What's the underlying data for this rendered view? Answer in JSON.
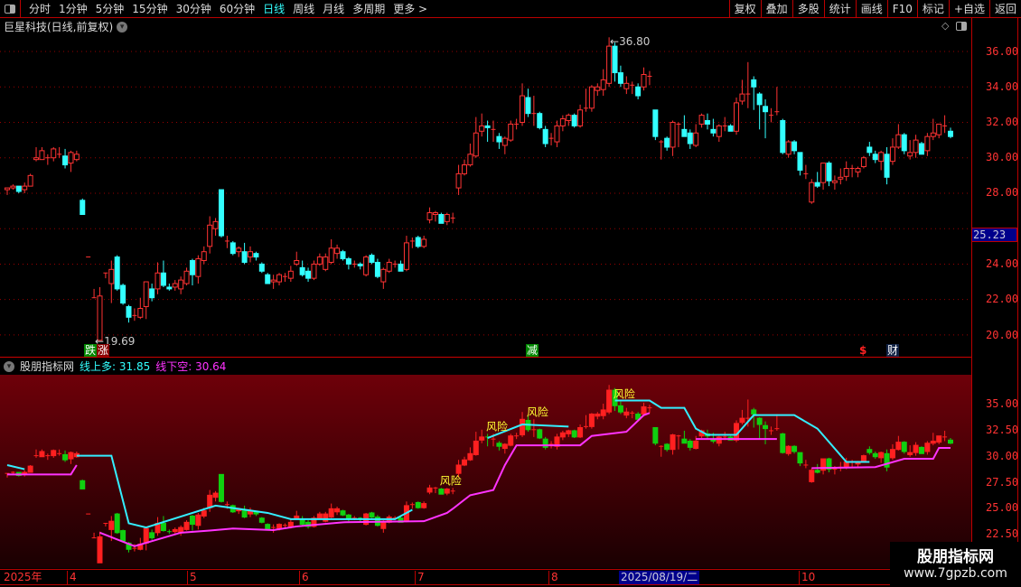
{
  "toolbar": {
    "periods": [
      "分时",
      "1分钟",
      "5分钟",
      "15分钟",
      "30分钟",
      "60分钟",
      "日线",
      "周线",
      "月线",
      "多周期",
      "更多 >"
    ],
    "active": "日线",
    "buttons": [
      "复权",
      "叠加",
      "多股",
      "统计",
      "画线",
      "F10",
      "标记",
      "+自选",
      "返回"
    ]
  },
  "header": {
    "title": "巨星科技(日线,前复权)"
  },
  "main_axis": {
    "labels": [
      "36.00",
      "34.00",
      "32.00",
      "30.00",
      "28.00",
      "24.00",
      "22.00",
      "20.00"
    ],
    "current_price": "25.23"
  },
  "annotations": {
    "high": "36.80",
    "low": "19.69",
    "die": "跌",
    "zhang": "涨",
    "jian": "减",
    "dollar": "$",
    "cai": "财",
    "risk": "风险"
  },
  "indicator": {
    "name": "股朋指标网",
    "upper_label": "线上多: 31.85",
    "lower_label": "线下空: 30.64",
    "axis": [
      "35.00",
      "32.50",
      "30.00",
      "27.50",
      "25.00",
      "22.50"
    ]
  },
  "time_axis": {
    "labels": [
      "2025年",
      "4",
      "5",
      "6",
      "7",
      "8",
      "10"
    ],
    "cursor_date": "2025/08/19/二"
  },
  "watermark": {
    "name": "股朋指标网",
    "url": "www.7gpzb.com"
  },
  "colors": {
    "up": "#ff3333",
    "down": "#33ffff",
    "upper_line": "#33eeff",
    "lower_line": "#ff33ff",
    "ind_up": "#ff2020",
    "ind_down": "#10d010",
    "risk": "#ffff33"
  },
  "chart_data": {
    "type": "candlestick",
    "ohlc": [
      [
        28.2,
        28.3,
        27.9,
        28.3
      ],
      [
        28.3,
        28.5,
        28.2,
        28.4
      ],
      [
        28.4,
        28.4,
        28.0,
        28.1
      ],
      [
        28.2,
        28.6,
        28.0,
        28.4
      ],
      [
        28.4,
        29.1,
        28.4,
        29.0
      ],
      [
        29.9,
        30.6,
        29.8,
        30.0
      ],
      [
        29.9,
        30.6,
        29.9,
        30.4
      ],
      [
        30.0,
        30.2,
        29.6,
        30.0
      ],
      [
        30.0,
        30.6,
        29.8,
        30.5
      ],
      [
        30.2,
        30.6,
        30.0,
        30.2
      ],
      [
        30.1,
        30.5,
        29.4,
        29.6
      ],
      [
        29.7,
        30.4,
        29.2,
        30.3
      ],
      [
        29.9,
        30.4,
        29.8,
        30.2
      ],
      [
        27.6,
        27.7,
        26.8,
        26.8
      ],
      [
        24.4,
        24.4,
        24.4,
        24.4
      ],
      [
        22.1,
        22.6,
        22.1,
        22.1
      ],
      [
        19.7,
        22.7,
        19.69,
        22.2
      ],
      [
        23.5,
        23.5,
        23.2,
        23.5
      ],
      [
        22.9,
        24.2,
        21.8,
        23.7
      ],
      [
        24.4,
        24.5,
        22.5,
        22.6
      ],
      [
        22.8,
        22.9,
        21.7,
        21.8
      ],
      [
        21.6,
        21.7,
        20.7,
        21.0
      ],
      [
        21.1,
        21.5,
        20.8,
        21.1
      ],
      [
        21.0,
        22.1,
        20.9,
        21.5
      ],
      [
        21.6,
        23.0,
        20.9,
        23.0
      ],
      [
        22.6,
        22.9,
        21.9,
        22.1
      ],
      [
        22.6,
        24.1,
        22.3,
        23.5
      ],
      [
        23.5,
        24.2,
        22.7,
        22.8
      ],
      [
        22.7,
        22.9,
        22.5,
        22.6
      ],
      [
        22.7,
        23.1,
        22.5,
        22.9
      ],
      [
        22.6,
        23.3,
        22.3,
        23.1
      ],
      [
        22.9,
        23.8,
        22.8,
        23.6
      ],
      [
        24.2,
        24.3,
        22.8,
        23.4
      ],
      [
        23.3,
        24.5,
        22.9,
        24.3
      ],
      [
        24.2,
        25.0,
        24.0,
        24.7
      ],
      [
        25.0,
        26.7,
        24.6,
        26.2
      ],
      [
        26.0,
        26.6,
        25.6,
        26.4
      ],
      [
        28.2,
        28.2,
        25.5,
        25.6
      ],
      [
        25.3,
        25.6,
        24.9,
        25.3
      ],
      [
        25.2,
        25.3,
        24.5,
        24.6
      ],
      [
        24.7,
        25.0,
        24.4,
        24.9
      ],
      [
        24.7,
        25.2,
        24.0,
        24.1
      ],
      [
        24.4,
        25.0,
        24.1,
        24.7
      ],
      [
        24.6,
        24.7,
        24.2,
        24.4
      ],
      [
        24.0,
        24.1,
        23.5,
        23.6
      ],
      [
        23.4,
        23.5,
        22.9,
        22.9
      ],
      [
        23.0,
        23.4,
        22.6,
        23.1
      ],
      [
        23.0,
        23.5,
        22.8,
        23.4
      ],
      [
        23.3,
        23.5,
        23.0,
        23.3
      ],
      [
        23.2,
        23.9,
        23.0,
        23.6
      ],
      [
        24.0,
        24.7,
        23.9,
        24.2
      ],
      [
        23.8,
        24.2,
        23.3,
        23.4
      ],
      [
        23.6,
        23.8,
        23.0,
        23.2
      ],
      [
        23.2,
        24.2,
        23.1,
        24.0
      ],
      [
        24.0,
        24.6,
        23.9,
        24.4
      ],
      [
        23.7,
        24.6,
        23.6,
        24.4
      ],
      [
        24.1,
        25.4,
        24.0,
        24.9
      ],
      [
        24.6,
        25.1,
        24.3,
        24.9
      ],
      [
        24.7,
        24.8,
        24.2,
        24.3
      ],
      [
        24.3,
        24.4,
        23.7,
        24.0
      ],
      [
        24.0,
        24.2,
        23.8,
        24.0
      ],
      [
        24.0,
        24.1,
        23.7,
        23.9
      ],
      [
        23.4,
        24.5,
        23.3,
        24.4
      ],
      [
        24.5,
        24.6,
        24.0,
        24.1
      ],
      [
        24.1,
        24.3,
        23.2,
        23.3
      ],
      [
        23.0,
        23.8,
        22.6,
        23.7
      ],
      [
        23.6,
        24.3,
        23.5,
        24.1
      ],
      [
        24.0,
        24.2,
        23.8,
        24.0
      ],
      [
        24.0,
        24.2,
        23.6,
        23.6
      ],
      [
        23.7,
        25.6,
        23.6,
        25.2
      ],
      [
        25.3,
        25.5,
        24.9,
        25.3
      ],
      [
        25.5,
        25.6,
        24.9,
        25.0
      ],
      [
        25.0,
        25.6,
        24.9,
        25.4
      ],
      [
        26.5,
        27.2,
        26.3,
        26.9
      ],
      [
        26.8,
        27.0,
        26.4,
        26.9
      ],
      [
        26.8,
        26.9,
        26.3,
        26.3
      ],
      [
        26.4,
        26.9,
        26.2,
        26.8
      ],
      [
        26.6,
        26.9,
        26.3,
        26.6
      ],
      [
        28.3,
        29.6,
        27.9,
        29.1
      ],
      [
        29.1,
        29.9,
        29.0,
        29.6
      ],
      [
        29.6,
        30.8,
        29.5,
        30.2
      ],
      [
        30.1,
        32.3,
        30.0,
        31.4
      ],
      [
        31.5,
        32.5,
        31.2,
        31.8
      ],
      [
        31.8,
        32.1,
        30.9,
        31.7
      ],
      [
        31.6,
        32.1,
        30.9,
        31.6
      ],
      [
        31.2,
        31.4,
        30.5,
        30.9
      ],
      [
        30.7,
        31.2,
        30.2,
        31.1
      ],
      [
        31.0,
        32.1,
        30.9,
        31.9
      ],
      [
        31.9,
        32.2,
        31.6,
        31.9
      ],
      [
        32.0,
        34.2,
        31.8,
        33.5
      ],
      [
        33.4,
        33.9,
        32.3,
        32.5
      ],
      [
        32.5,
        33.5,
        31.8,
        32.5
      ],
      [
        32.5,
        32.6,
        31.6,
        31.7
      ],
      [
        31.6,
        31.8,
        30.6,
        30.8
      ],
      [
        31.1,
        31.4,
        30.7,
        31.1
      ],
      [
        30.9,
        32.1,
        30.6,
        31.8
      ],
      [
        31.8,
        32.4,
        31.5,
        32.2
      ],
      [
        32.1,
        32.5,
        31.8,
        32.4
      ],
      [
        32.4,
        32.5,
        31.7,
        31.8
      ],
      [
        31.8,
        33.0,
        31.7,
        32.7
      ],
      [
        32.8,
        33.9,
        32.6,
        32.8
      ],
      [
        32.8,
        34.1,
        32.6,
        34.0
      ],
      [
        33.8,
        34.2,
        33.5,
        34.0
      ],
      [
        33.85,
        35.0,
        33.5,
        34.4
      ],
      [
        34.2,
        36.8,
        34.0,
        36.3
      ],
      [
        36.3,
        36.5,
        34.3,
        34.8
      ],
      [
        34.8,
        35.2,
        34.0,
        34.2
      ],
      [
        33.9,
        34.6,
        33.6,
        34.2
      ],
      [
        34.1,
        34.3,
        33.6,
        34.1
      ],
      [
        34.0,
        34.2,
        33.3,
        33.5
      ],
      [
        34.0,
        35.1,
        33.8,
        34.7
      ],
      [
        34.6,
        34.9,
        34.1,
        34.6
      ],
      [
        32.7,
        32.7,
        31.0,
        31.2
      ],
      [
        30.9,
        31.0,
        29.9,
        30.9
      ],
      [
        31.1,
        31.2,
        30.4,
        30.6
      ],
      [
        30.6,
        32.1,
        30.1,
        32.0
      ],
      [
        31.9,
        32.0,
        30.6,
        31.9
      ],
      [
        31.6,
        32.4,
        31.2,
        31.2
      ],
      [
        31.4,
        31.6,
        30.5,
        30.8
      ],
      [
        30.7,
        31.9,
        30.6,
        31.4
      ],
      [
        31.9,
        32.5,
        31.7,
        32.4
      ],
      [
        32.1,
        32.5,
        31.6,
        31.9
      ],
      [
        31.6,
        32.2,
        31.2,
        31.4
      ],
      [
        31.2,
        31.9,
        30.9,
        31.8
      ],
      [
        31.8,
        32.3,
        31.5,
        31.8
      ],
      [
        31.8,
        31.9,
        31.5,
        31.5
      ],
      [
        31.5,
        33.4,
        31.3,
        33.1
      ],
      [
        33.2,
        34.4,
        33.0,
        33.6
      ],
      [
        33.6,
        35.4,
        32.8,
        33.6
      ],
      [
        34.4,
        34.6,
        32.7,
        34.0
      ],
      [
        33.6,
        33.7,
        31.6,
        33.0
      ],
      [
        32.9,
        33.3,
        31.1,
        32.6
      ],
      [
        32.4,
        32.8,
        32.0,
        32.4
      ],
      [
        32.6,
        34.0,
        32.4,
        32.6
      ],
      [
        32.1,
        32.2,
        30.2,
        30.3
      ],
      [
        30.2,
        31.0,
        30.0,
        30.9
      ],
      [
        30.9,
        31.0,
        30.2,
        30.4
      ],
      [
        30.3,
        30.3,
        29.0,
        29.3
      ],
      [
        29.1,
        29.6,
        28.8,
        29.1
      ],
      [
        27.5,
        28.8,
        27.4,
        28.6
      ],
      [
        28.6,
        29.2,
        28.3,
        28.4
      ],
      [
        28.6,
        29.7,
        28.2,
        29.7
      ],
      [
        29.7,
        29.8,
        28.4,
        28.7
      ],
      [
        28.6,
        29.0,
        28.2,
        28.7
      ],
      [
        28.8,
        29.4,
        28.5,
        28.9
      ],
      [
        28.95,
        29.8,
        28.7,
        29.4
      ],
      [
        29.4,
        29.6,
        28.9,
        29.4
      ],
      [
        29.2,
        29.5,
        28.9,
        29.4
      ],
      [
        29.5,
        30.1,
        29.4,
        30.0
      ],
      [
        30.6,
        30.9,
        30.1,
        30.3
      ],
      [
        30.2,
        30.4,
        29.7,
        29.9
      ],
      [
        29.8,
        30.4,
        29.3,
        30.3
      ],
      [
        30.2,
        30.6,
        28.5,
        28.9
      ],
      [
        29.8,
        31.1,
        29.6,
        30.6
      ],
      [
        30.6,
        31.9,
        30.5,
        31.3
      ],
      [
        31.3,
        31.4,
        30.2,
        30.4
      ],
      [
        30.1,
        31.0,
        29.9,
        30.3
      ],
      [
        30.3,
        31.3,
        30.0,
        31.0
      ],
      [
        30.8,
        30.9,
        30.2,
        30.2
      ],
      [
        30.4,
        31.4,
        30.1,
        31.2
      ],
      [
        31.2,
        32.2,
        31.0,
        31.4
      ],
      [
        31.3,
        31.9,
        31.1,
        31.9
      ],
      [
        31.8,
        32.4,
        31.4,
        31.8
      ],
      [
        31.5,
        31.7,
        31.1,
        31.2
      ]
    ],
    "main_ylim": [
      19,
      37.5
    ],
    "indicator_ylim": [
      21.5,
      37.5
    ],
    "upper_line": [
      [
        [
          0,
          29.1
        ],
        [
          3,
          28.7
        ]
      ],
      [
        [
          12,
          30.0
        ],
        [
          18,
          30.0
        ],
        [
          21,
          23.5
        ],
        [
          24,
          23.1
        ],
        [
          36,
          25.2
        ],
        [
          45,
          24.5
        ],
        [
          49,
          23.9
        ],
        [
          67,
          23.9
        ],
        [
          70,
          24.8
        ]
      ],
      [
        [
          83,
          31.7
        ],
        [
          89,
          33.0
        ],
        [
          97,
          32.8
        ]
      ],
      [
        [
          105,
          35.3
        ],
        [
          111,
          35.3
        ],
        [
          113,
          34.6
        ],
        [
          117,
          34.6
        ],
        [
          119,
          32.6
        ],
        [
          121,
          32.0
        ],
        [
          126,
          32.0
        ],
        [
          129,
          33.9
        ],
        [
          136,
          33.9
        ],
        [
          140,
          32.6
        ],
        [
          145,
          29.4
        ],
        [
          149,
          29.4
        ]
      ]
    ],
    "lower_line": [
      [
        [
          0,
          28.2
        ],
        [
          11,
          28.2
        ],
        [
          12,
          29.1
        ]
      ],
      [
        [
          16,
          22.6
        ],
        [
          22,
          21.3
        ],
        [
          30,
          22.6
        ],
        [
          35,
          22.8
        ],
        [
          39,
          23.0
        ],
        [
          46,
          22.85
        ],
        [
          50,
          23.2
        ],
        [
          58,
          23.6
        ],
        [
          72,
          23.7
        ],
        [
          76,
          24.5
        ],
        [
          77,
          24.9
        ],
        [
          80,
          26.2
        ],
        [
          84,
          26.7
        ],
        [
          86,
          29.1
        ],
        [
          88,
          31.0
        ],
        [
          99,
          31.0
        ],
        [
          101,
          31.9
        ],
        [
          107,
          32.3
        ],
        [
          110,
          33.9
        ],
        [
          111,
          34.1
        ]
      ],
      [
        [
          119,
          31.6
        ],
        [
          133,
          31.6
        ]
      ],
      [
        [
          139,
          28.8
        ],
        [
          150,
          28.9
        ],
        [
          155,
          29.7
        ],
        [
          160,
          29.7
        ],
        [
          161,
          30.75
        ],
        [
          163,
          30.75
        ]
      ]
    ],
    "risk_bars": [
      76,
      84,
      91,
      106
    ]
  }
}
